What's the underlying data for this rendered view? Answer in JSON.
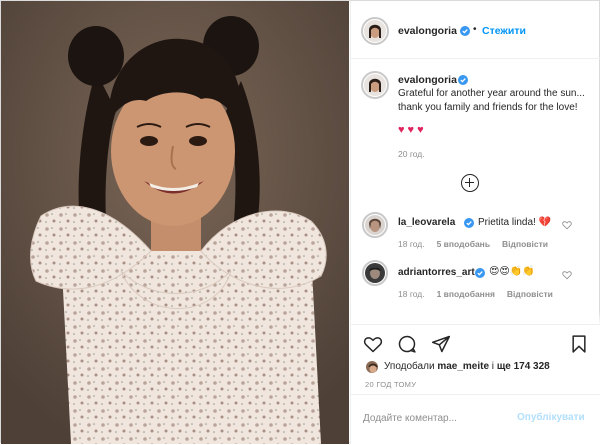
{
  "post": {
    "author": {
      "username": "evalongoria",
      "verified": true,
      "follow_label": "Стежити",
      "separator": "•"
    },
    "photo": {
      "subject": "childhood portrait of a smiling girl with pigtails in a floral ruffled dress"
    },
    "caption": {
      "username": "evalongoria",
      "text": "Grateful for another year around the sun... thank you family and friends for the love!",
      "hearts": [
        "♥",
        "♥",
        "♥"
      ],
      "time": "20 год."
    },
    "load_more_icon": "plus-circle-icon",
    "comments": [
      {
        "username": "la_leovarela",
        "verified": true,
        "text": "Prietita linda! 💔",
        "time": "18 год.",
        "likes": "5 вподобань",
        "reply": "Відповісти"
      },
      {
        "username": "adriantorres_art",
        "verified": true,
        "text": "😍😍👏👏",
        "time": "18 год.",
        "likes": "1 вподобання",
        "reply": "Відповісти"
      }
    ],
    "actions": {
      "icons": [
        "heart-icon",
        "comment-icon",
        "share-icon",
        "bookmark-icon"
      ]
    },
    "likes_summary": {
      "prefix": "Уподобали ",
      "user": "mae_meite",
      "middle": " і ",
      "count": "ще 174 328"
    },
    "posted_ago": "20 ГОД ТОМУ",
    "comment_form": {
      "placeholder": "Додайте коментар...",
      "publish_label": "Опублікувати"
    }
  },
  "colors": {
    "accent": "#0095f6",
    "publish_disabled": "#b2dffc",
    "heart": "#e0245e",
    "muted": "#8e8e8e",
    "border": "#efefef"
  }
}
